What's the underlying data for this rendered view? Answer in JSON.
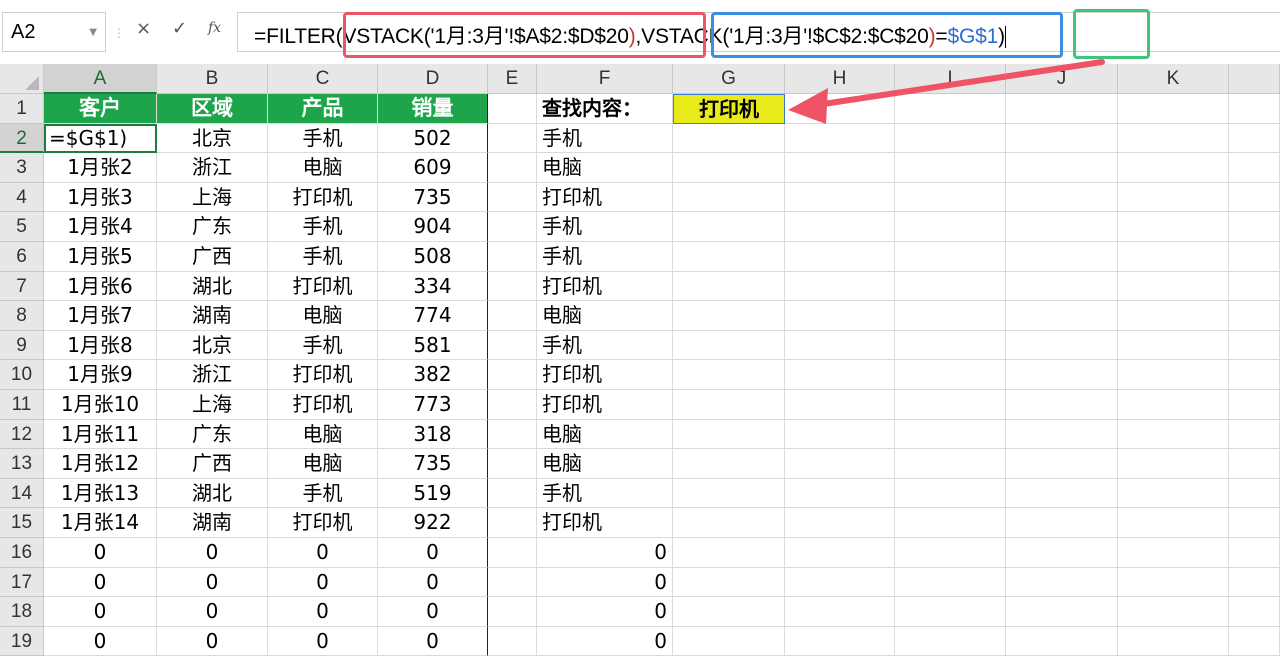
{
  "formula_bar": {
    "name_box": "A2",
    "cancel_glyph": "×",
    "enter_glyph": "✓",
    "fx_label": "fx",
    "formula_parts": [
      {
        "text": "=FILTER(",
        "color": "#000000"
      },
      {
        "text": "VSTACK(",
        "color": "#000000"
      },
      {
        "text": "'1月:3月'!$A$2:$D$20",
        "color": "#000000"
      },
      {
        "text": ")",
        "color": "#c0392b"
      },
      {
        "text": ",",
        "color": "#000000"
      },
      {
        "text": "VSTACK(",
        "color": "#000000"
      },
      {
        "text": "'1月:3月'!$C$2:$C$20",
        "color": "#000000"
      },
      {
        "text": ")",
        "color": "#c0392b"
      },
      {
        "text": "=",
        "color": "#000000"
      },
      {
        "text": "$G$1",
        "color": "#2b6fd6"
      },
      {
        "text": ")",
        "color": "#000000"
      }
    ],
    "highlight_colors": {
      "red": "#ee5366",
      "blue": "#3a8ee6",
      "green": "#3fc67b"
    }
  },
  "columns": [
    "A",
    "B",
    "C",
    "D",
    "E",
    "F",
    "G",
    "H",
    "I",
    "J",
    "K"
  ],
  "rows": [
    "1",
    "2",
    "3",
    "4",
    "5",
    "6",
    "7",
    "8",
    "9",
    "10",
    "11",
    "12",
    "13",
    "14",
    "15",
    "16",
    "17",
    "18",
    "19"
  ],
  "table": {
    "headers": [
      "客户",
      "区域",
      "产品",
      "销量"
    ],
    "body": [
      [
        "=$G$1)",
        "北京",
        "手机",
        "502"
      ],
      [
        "1月张2",
        "浙江",
        "电脑",
        "609"
      ],
      [
        "1月张3",
        "上海",
        "打印机",
        "735"
      ],
      [
        "1月张4",
        "广东",
        "手机",
        "904"
      ],
      [
        "1月张5",
        "广西",
        "手机",
        "508"
      ],
      [
        "1月张6",
        "湖北",
        "打印机",
        "334"
      ],
      [
        "1月张7",
        "湖南",
        "电脑",
        "774"
      ],
      [
        "1月张8",
        "北京",
        "手机",
        "581"
      ],
      [
        "1月张9",
        "浙江",
        "打印机",
        "382"
      ],
      [
        "1月张10",
        "上海",
        "打印机",
        "773"
      ],
      [
        "1月张11",
        "广东",
        "电脑",
        "318"
      ],
      [
        "1月张12",
        "广西",
        "电脑",
        "735"
      ],
      [
        "1月张13",
        "湖北",
        "手机",
        "519"
      ],
      [
        "1月张14",
        "湖南",
        "打印机",
        "922"
      ],
      [
        "0",
        "0",
        "0",
        "0"
      ],
      [
        "0",
        "0",
        "0",
        "0"
      ],
      [
        "0",
        "0",
        "0",
        "0"
      ],
      [
        "0",
        "0",
        "0",
        "0"
      ]
    ],
    "header_color": "#1ea54b"
  },
  "lookup": {
    "label": "查找内容：",
    "value": "打印机",
    "value_bg": "#e8ea1a"
  },
  "column_f": [
    "手机",
    "电脑",
    "打印机",
    "手机",
    "手机",
    "打印机",
    "电脑",
    "手机",
    "打印机",
    "打印机",
    "电脑",
    "电脑",
    "手机",
    "打印机",
    "0",
    "0",
    "0",
    "0"
  ],
  "arrow_color": "#ee5366"
}
